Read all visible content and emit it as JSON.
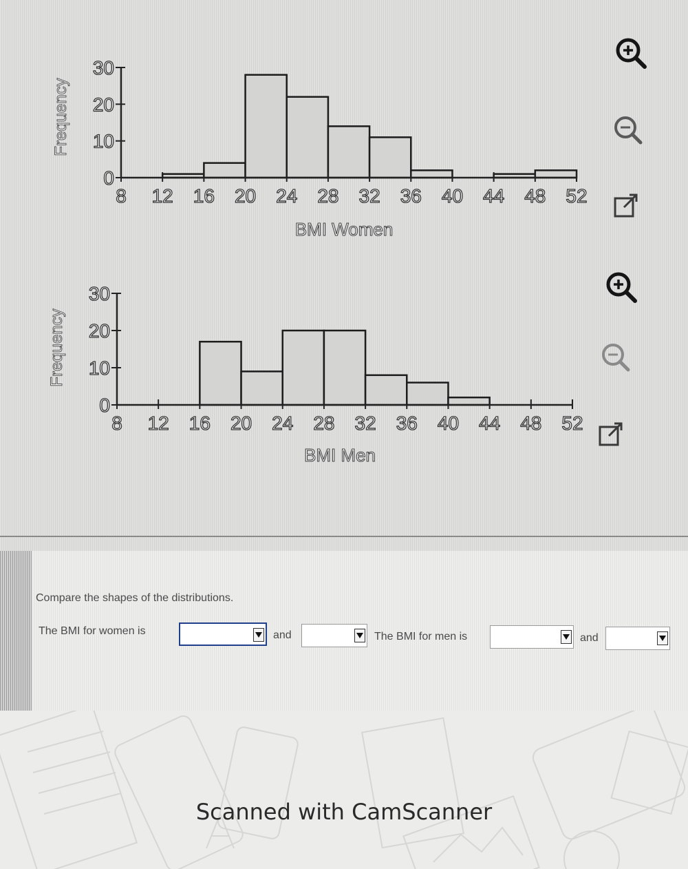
{
  "chart_data": [
    {
      "type": "bar",
      "bin_edges": [
        8,
        12,
        16,
        20,
        24,
        28,
        32,
        36,
        40,
        44,
        48,
        52
      ],
      "values": [
        0,
        1,
        4,
        28,
        22,
        14,
        11,
        2,
        0,
        1,
        2
      ],
      "xticks": [
        8,
        12,
        16,
        20,
        24,
        28,
        32,
        36,
        40,
        44,
        48,
        52
      ],
      "yticks": [
        0,
        10,
        20,
        30
      ],
      "xlabel": "BMI Women",
      "ylabel": "Frequency",
      "xlim": [
        8,
        52
      ],
      "ylim": [
        0,
        30
      ]
    },
    {
      "type": "bar",
      "bin_edges": [
        8,
        12,
        16,
        20,
        24,
        28,
        32,
        36,
        40,
        44,
        48,
        52
      ],
      "values": [
        0,
        0,
        17,
        9,
        20,
        20,
        8,
        6,
        2,
        0,
        0
      ],
      "xticks": [
        8,
        12,
        16,
        20,
        24,
        28,
        32,
        36,
        40,
        44,
        48,
        52
      ],
      "yticks": [
        0,
        10,
        20,
        30
      ],
      "xlabel": "BMI Men",
      "ylabel": "Frequency",
      "xlim": [
        8,
        52
      ],
      "ylim": [
        0,
        30
      ]
    }
  ],
  "question": {
    "prompt": "Compare the shapes of the distributions.",
    "women_label": "The BMI for women is",
    "and_1": "and",
    "men_label": "The BMI for men is",
    "and_2": "and"
  },
  "dropdowns": {
    "women_shape_1": "",
    "women_shape_2": "",
    "men_shape_1": "",
    "men_shape_2": ""
  },
  "icons": [
    "zoom-in-icon",
    "zoom-out-icon",
    "expand-icon"
  ],
  "footer": {
    "text": "Scanned with CamScanner"
  },
  "colors": {
    "bar_fill": "#d4d4d2",
    "bar_stroke": "#1c1c1c",
    "active_dropdown_border": "#1f3f8a"
  }
}
